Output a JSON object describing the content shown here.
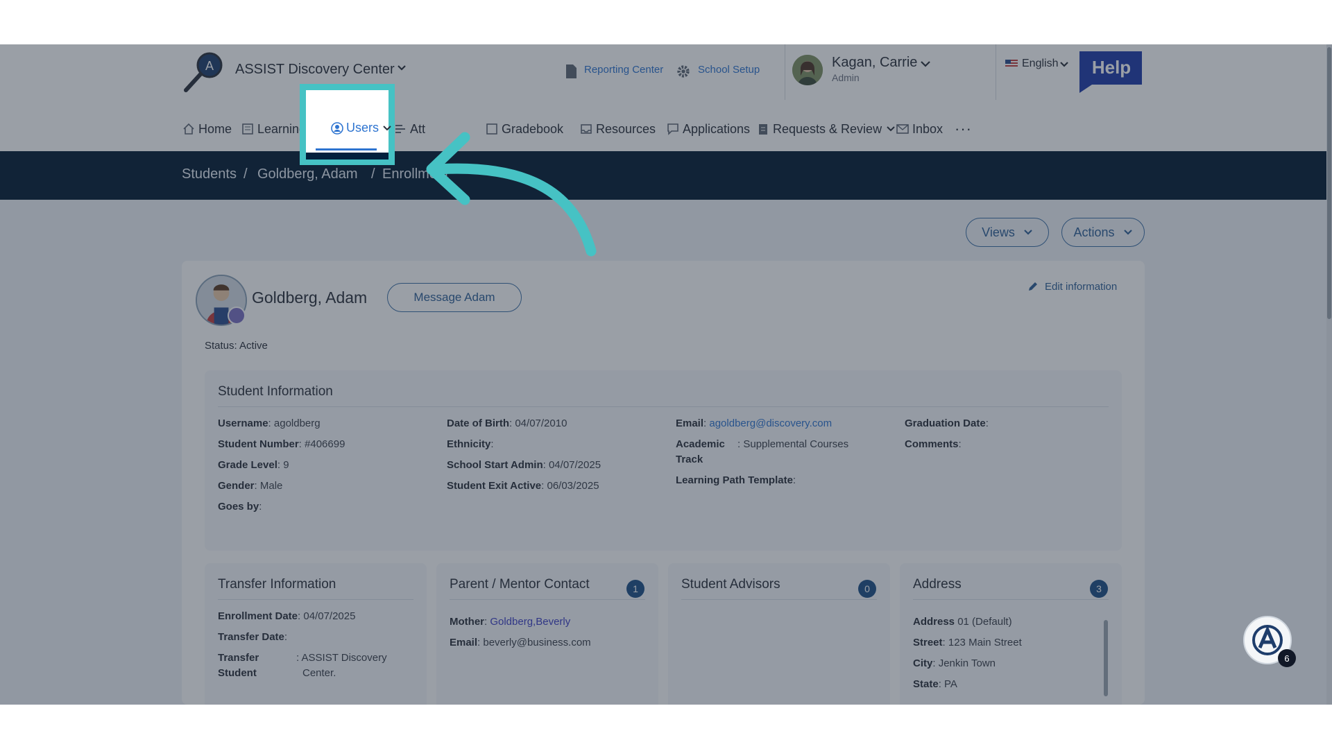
{
  "header": {
    "app_title": "ASSIST Discovery Center",
    "reporting_center": "Reporting Center",
    "school_setup": "School Setup",
    "user_name": "Kagan, Carrie",
    "user_role": "Admin",
    "language": "English",
    "help_label": "Help"
  },
  "nav": {
    "home": "Home",
    "learning": "Learning",
    "users": "Users",
    "attendance": "Att",
    "gradebook": "Gradebook",
    "resources": "Resources",
    "applications": "Applications",
    "requests": "Requests & Review",
    "inbox": "Inbox",
    "more": "···"
  },
  "breadcrumb": {
    "students": "Students",
    "sep1": "/",
    "student": "Goldberg, Adam",
    "sep2": "/",
    "page": "Enrollment"
  },
  "toolbar": {
    "views": "Views",
    "actions": "Actions"
  },
  "profile": {
    "name": "Goldberg, Adam",
    "message_button": "Message Adam",
    "edit_info": "Edit information",
    "status_label": "Status:",
    "status_value": "Active"
  },
  "student_info": {
    "title": "Student Information",
    "col1": [
      {
        "label": "Username",
        "value": "agoldberg"
      },
      {
        "label": "Student Number",
        "value": "#406699"
      },
      {
        "label": "Grade Level",
        "value": "9"
      },
      {
        "label": "Gender",
        "value": "Male"
      },
      {
        "label": "Goes by",
        "value": ""
      }
    ],
    "col2": [
      {
        "label": "Date of Birth",
        "value": "04/07/2010"
      },
      {
        "label": "Ethnicity",
        "value": ""
      },
      {
        "label": "School Start Admin",
        "value": "04/07/2025"
      },
      {
        "label": "Student Exit Active",
        "value": "06/03/2025"
      }
    ],
    "email_label": "Email",
    "email_value": "agoldberg@discovery.com",
    "academic_label": "Academic",
    "academic_label2": "Track",
    "academic_value": "Supplemental Courses",
    "lpt_label": "Learning Path Template",
    "graduation_label": "Graduation Date",
    "comments_label": "Comments"
  },
  "transfer": {
    "title": "Transfer Information",
    "enroll_label": "Enrollment Date",
    "enroll_value": "04/07/2025",
    "transfer_date_label": "Transfer Date",
    "transfer_student_label1": "Transfer",
    "transfer_student_label2": "Student",
    "transfer_student_value1": "ASSIST Discovery",
    "transfer_student_value2": "Center."
  },
  "parent": {
    "title": "Parent / Mentor Contact",
    "count": "1",
    "mother_label": "Mother",
    "mother_value": "Goldberg,Beverly",
    "email_label": "Email",
    "email_value": "beverly@business.com"
  },
  "advisors": {
    "title": "Student Advisors",
    "count": "0"
  },
  "address": {
    "title": "Address",
    "count": "3",
    "addr_label": "Address",
    "addr_value": "01 (Default)",
    "street_label": "Street",
    "street_value": "123 Main Street",
    "city_label": "City",
    "city_value": "Jenkin Town",
    "state_label": "State",
    "state_value": "PA"
  },
  "fab": {
    "badge": "6"
  },
  "colors": {
    "accent": "#2e74d0",
    "highlight": "#46c2c4",
    "breadcrumb_bg": "#031a33",
    "badge": "#1c4f86"
  }
}
